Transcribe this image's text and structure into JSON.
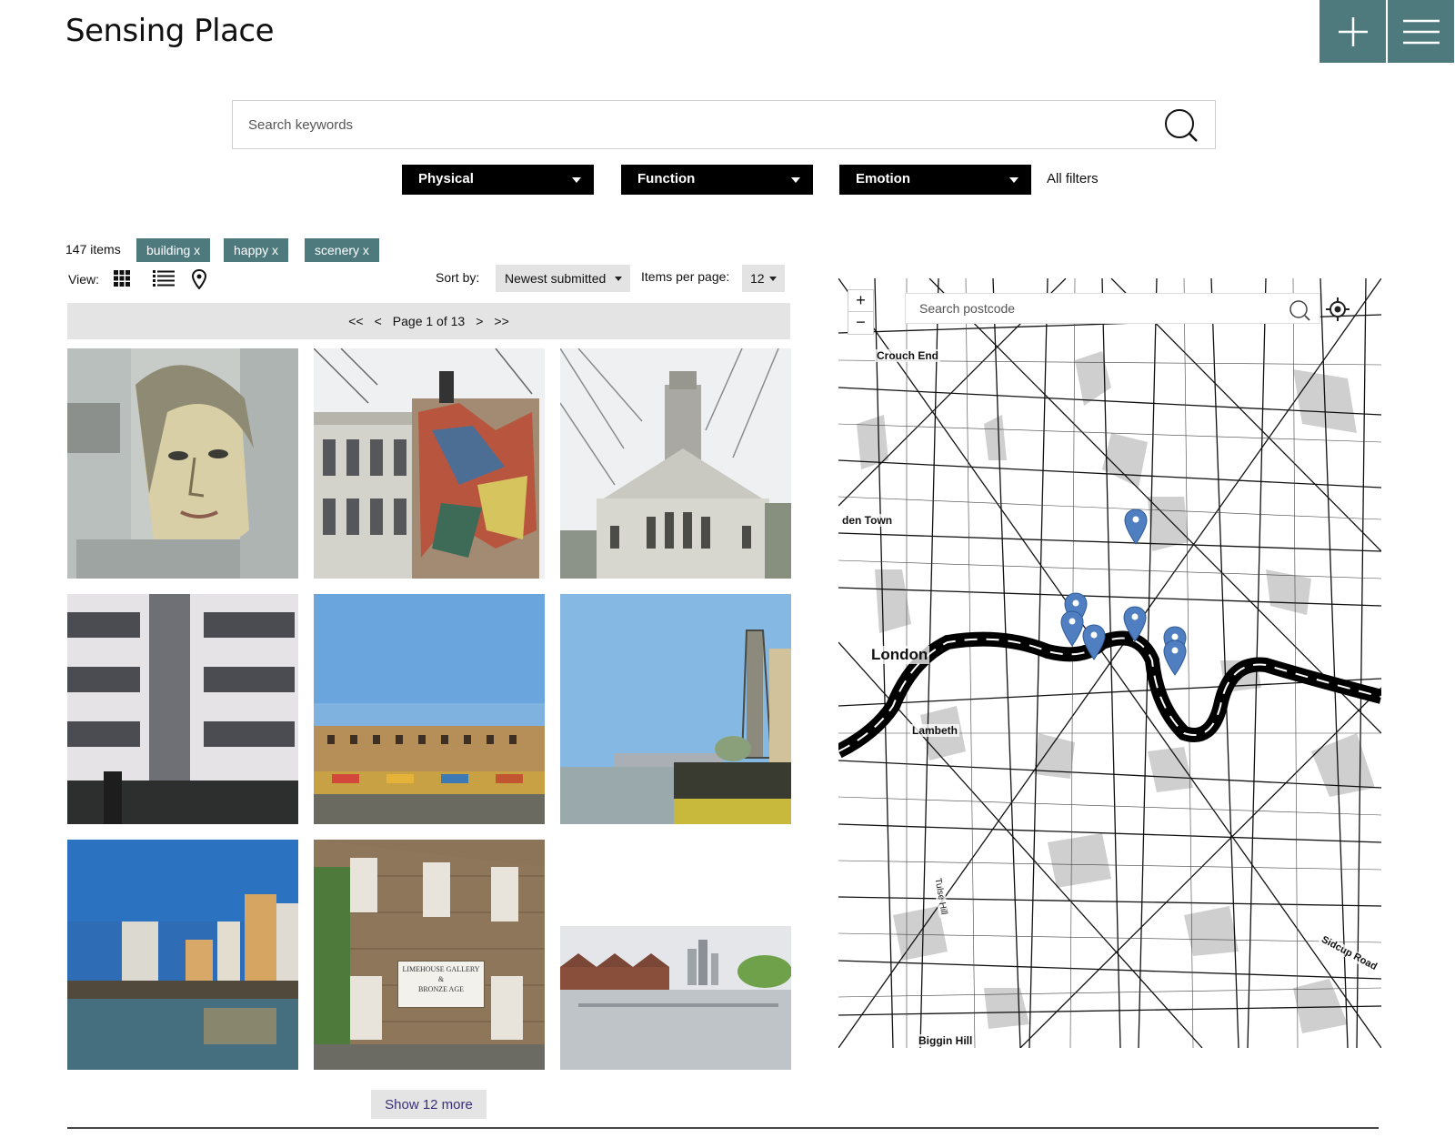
{
  "site": {
    "title": "Sensing Place"
  },
  "header": {
    "add_icon": "plus-icon",
    "menu_icon": "hamburger-menu-icon"
  },
  "search": {
    "placeholder": "Search keywords",
    "value": "",
    "icon": "search-icon"
  },
  "filters": [
    {
      "label": "Physical"
    },
    {
      "label": "Function"
    },
    {
      "label": "Emotion"
    }
  ],
  "all_filters": "All filters",
  "results": {
    "count_text": "147 items",
    "tags": [
      "building x",
      "happy x",
      "scenery x"
    ]
  },
  "view": {
    "label": "View:",
    "options": [
      "grid-view-icon",
      "list-view-icon",
      "map-pin-view-icon"
    ]
  },
  "sort": {
    "label": "Sort by:",
    "selected": "Newest submitted"
  },
  "items_per_page": {
    "label": "Items per page:",
    "selected": "12"
  },
  "pager": {
    "first": "<<",
    "prev": "<",
    "text": "Page 1 of 13",
    "next": ">",
    "last": ">>"
  },
  "gallery": [
    {
      "subject": "mural-portrait"
    },
    {
      "subject": "mural-building"
    },
    {
      "subject": "church"
    },
    {
      "subject": "modern-building"
    },
    {
      "subject": "dock-warehouses"
    },
    {
      "subject": "river-view"
    },
    {
      "subject": "marina"
    },
    {
      "subject": "limehouse-gallery"
    },
    {
      "subject": "river-canary-wharf"
    }
  ],
  "gallery_sign": {
    "line1": "LIMEHOUSE GALLERY",
    "line2": "&",
    "line3": "BRONZE AGE"
  },
  "show_more": "Show 12 more",
  "map": {
    "zoom_in": "+",
    "zoom_out": "−",
    "search_placeholder": "Search postcode",
    "labels": {
      "crouch_end": "Crouch End",
      "camden": "den Town",
      "london": "London",
      "lambeth": "Lambeth",
      "biggin_hill": "Biggin Hill",
      "sidcup_road": "Sidcup Road",
      "tulse_hill": "Tulse Hill"
    },
    "pin_color": "#4f7fc0"
  },
  "colors": {
    "accent": "#4e7a7e",
    "filter_bg": "#000000",
    "pager_bg": "#e4e4e4"
  }
}
